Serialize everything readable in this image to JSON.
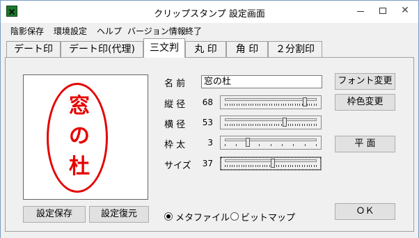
{
  "window": {
    "title": "クリップスタンプ  設定画面",
    "close_symbol": "✕"
  },
  "menu": [
    "陰影保存",
    "環境設定",
    "ヘルプ",
    "バージョン情報",
    "終了"
  ],
  "tabs": [
    "デート印",
    "デート印(代理)",
    "三文判",
    "丸 印",
    "角 印",
    "２分割印"
  ],
  "active_tab": "三文判",
  "preview": {
    "chars": [
      "窓",
      "の",
      "杜"
    ],
    "stamp_color": "#e60000"
  },
  "form": {
    "name_label": "名 前",
    "name_value": "窓の杜",
    "height_label": "縦 径",
    "height_value": "68",
    "width_label": "横 径",
    "width_value": "53",
    "border_label": "枠 太",
    "border_value": "3",
    "size_label": "サイズ",
    "size_value": "37"
  },
  "sliders": {
    "height_fraction": 0.87,
    "width_fraction": 0.65,
    "border_fraction": 0.25,
    "size_fraction": 0.52
  },
  "buttons": {
    "font_change": "フォント変更",
    "frame_color_change": "枠色変更",
    "flat": "平  面",
    "save_settings": "設定保存",
    "restore_settings": "設定復元",
    "ok": "ＯＫ"
  },
  "output": {
    "metafile_label": "メタファイル",
    "bitmap_label": "ビットマップ",
    "selected": "metafile"
  }
}
